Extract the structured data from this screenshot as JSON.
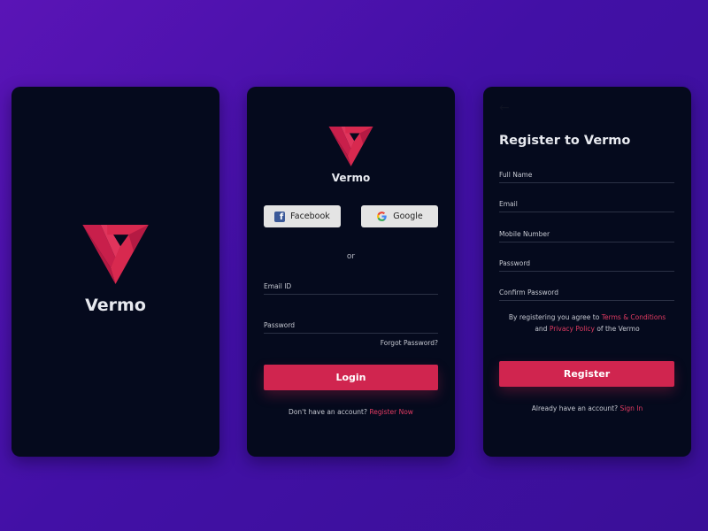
{
  "colors": {
    "background_gradient_start": "#5a14b6",
    "background_gradient_end": "#3a0f98",
    "card_background": "#050a1d",
    "accent": "#d0254f",
    "link_accent": "#e23b62",
    "social_button": "#e4e4e4"
  },
  "splash": {
    "app_name": "Vermo",
    "logo_icon": "vermo-logo-icon"
  },
  "login": {
    "app_name": "Vermo",
    "facebook_label": "Facebook",
    "google_label": "Google",
    "or_text": "or",
    "email_label": "Email ID",
    "password_label": "Password",
    "forgot_password": "Forgot Password?",
    "login_button": "Login",
    "no_account_text": "Don't have an account?",
    "register_link": "Register Now"
  },
  "register": {
    "back_icon": "arrow-left-icon",
    "title": "Register to Vermo",
    "fields": {
      "full_name": "Full Name",
      "email": "Email",
      "mobile": "Mobile Number",
      "password": "Password",
      "confirm_password": "Confirm Password"
    },
    "terms_prefix": "By registering you agree to",
    "terms_link": "Terms & Conditions",
    "terms_and": "and",
    "privacy_link": "Privacy Policy",
    "terms_suffix": "of the Vermo",
    "register_button": "Register",
    "have_account_text": "Already have an account?",
    "sign_in_link": "Sign In"
  }
}
